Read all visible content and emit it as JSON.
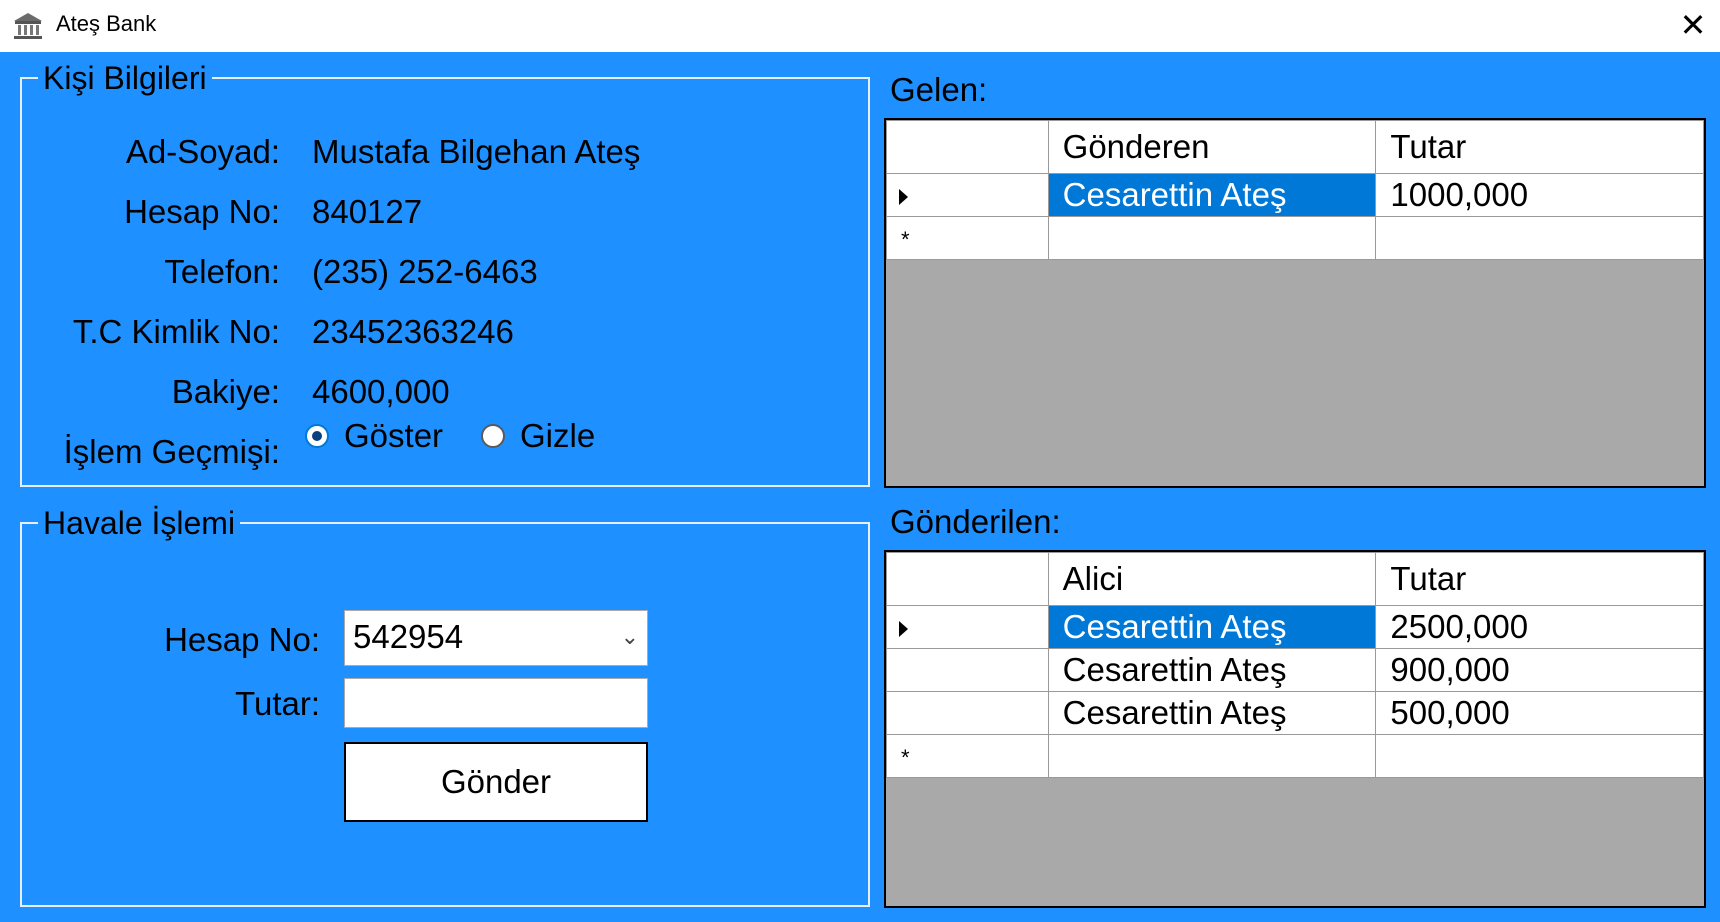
{
  "window": {
    "title": "Ateş Bank",
    "icon": "bank-icon",
    "close_label": "✕"
  },
  "kisi": {
    "legend": "Kişi Bilgileri",
    "ad_label": "Ad-Soyad:",
    "ad_value": "Mustafa Bilgehan Ateş",
    "hesap_label": "Hesap No:",
    "hesap_value": "840127",
    "tel_label": "Telefon:",
    "tel_value": "(235) 252-6463",
    "tc_label": "T.C Kimlik No:",
    "tc_value": "23452363246",
    "bakiye_label": "Bakiye:",
    "bakiye_value": "4600,000",
    "gecmis_label": "İşlem Geçmişi:",
    "goster_label": "Göster",
    "gizle_label": "Gizle",
    "selected": "Göster"
  },
  "havale": {
    "legend": "Havale İşlemi",
    "hesap_label": "Hesap No:",
    "hesap_value": "542954",
    "tutar_label": "Tutar:",
    "tutar_value": "",
    "send_label": "Gönder"
  },
  "gelen": {
    "label": "Gelen:",
    "columns": [
      "Gönderen",
      "Tutar"
    ],
    "rows": [
      {
        "col1": "Cesarettin Ateş",
        "col2": "1000,000"
      }
    ]
  },
  "gonderilen": {
    "label": "Gönderilen:",
    "columns": [
      "Alici",
      "Tutar"
    ],
    "rows": [
      {
        "col1": "Cesarettin Ateş",
        "col2": "2500,000"
      },
      {
        "col1": "Cesarettin Ateş",
        "col2": "900,000"
      },
      {
        "col1": "Cesarettin Ateş",
        "col2": "500,000"
      }
    ]
  },
  "colors": {
    "background": "#1e90ff",
    "selection": "#0078d7",
    "grid_empty": "#a9a9a9"
  }
}
